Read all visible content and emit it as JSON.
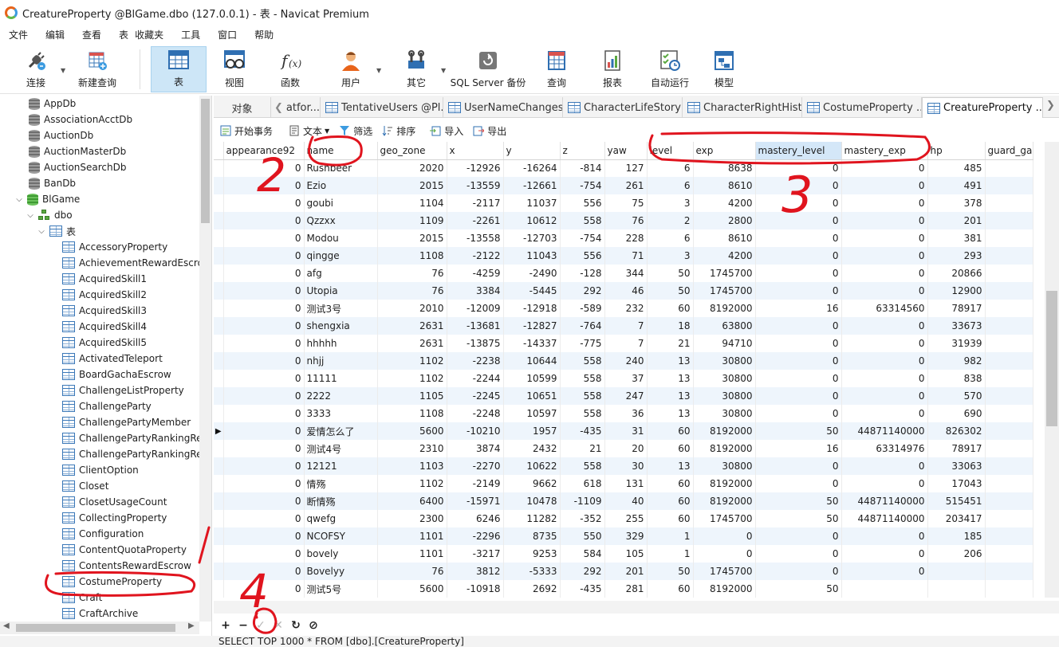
{
  "window": {
    "title": "CreatureProperty @BlGame.dbo (127.0.0.1) - 表 - Navicat Premium"
  },
  "menu": [
    "文件",
    "编辑",
    "查看",
    "表",
    "收藏夹",
    "工具",
    "窗口",
    "帮助"
  ],
  "toolbar": {
    "connect": "连接",
    "new_query": "新建查询",
    "table": "表",
    "view": "视图",
    "function": "函数",
    "user": "用户",
    "other": "其它",
    "backup": "SQL Server 备份",
    "query": "查询",
    "report": "报表",
    "automation": "自动运行",
    "model": "模型"
  },
  "sidebar": {
    "databases": [
      "AppDb",
      "AssociationAcctDb",
      "AuctionDb",
      "AuctionMasterDb",
      "AuctionSearchDb",
      "BanDb",
      "BlGame"
    ],
    "schema": "dbo",
    "tables_node": "表",
    "tables": [
      "AccessoryProperty",
      "AchievementRewardEscro",
      "AcquiredSkill1",
      "AcquiredSkill2",
      "AcquiredSkill3",
      "AcquiredSkill4",
      "AcquiredSkill5",
      "ActivatedTeleport",
      "BoardGachaEscrow",
      "ChallengeListProperty",
      "ChallengeParty",
      "ChallengePartyMember",
      "ChallengePartyRankingRe",
      "ChallengePartyRankingRe",
      "ClientOption",
      "Closet",
      "ClosetUsageCount",
      "CollectingProperty",
      "Configuration",
      "ContentQuotaProperty",
      "ContentsRewardEscrow",
      "CostumeProperty",
      "Craft",
      "CraftArchive"
    ]
  },
  "tabs": [
    "对象",
    "atfor...",
    "TentativeUsers @Pl...",
    "UserNameChanges...",
    "CharacterLifeStory ...",
    "CharacterRightHist...",
    "CostumeProperty ...",
    "CreatureProperty ..."
  ],
  "subtoolbar": {
    "begin_transaction": "开始事务",
    "text": "文本",
    "filter": "筛选",
    "sort": "排序",
    "import": "导入",
    "export": "导出"
  },
  "grid": {
    "columns": [
      "appearance92",
      "name",
      "geo_zone",
      "x",
      "y",
      "z",
      "yaw",
      "level",
      "exp",
      "mastery_level",
      "mastery_exp",
      "hp",
      "guard_ga"
    ],
    "rows": [
      [
        "0",
        "Rushbeer",
        "2020",
        "-12926",
        "-16264",
        "-814",
        "127",
        "6",
        "8638",
        "0",
        "0",
        "485",
        ""
      ],
      [
        "0",
        "Ezio",
        "2015",
        "-13559",
        "-12661",
        "-754",
        "261",
        "6",
        "8610",
        "0",
        "0",
        "491",
        ""
      ],
      [
        "0",
        "goubi",
        "1104",
        "-2117",
        "11037",
        "556",
        "75",
        "3",
        "4200",
        "0",
        "0",
        "378",
        ""
      ],
      [
        "0",
        "Qzzxx",
        "1109",
        "-2261",
        "10612",
        "558",
        "76",
        "2",
        "2800",
        "0",
        "0",
        "201",
        ""
      ],
      [
        "0",
        "Modou",
        "2015",
        "-13558",
        "-12703",
        "-754",
        "228",
        "6",
        "8610",
        "0",
        "0",
        "381",
        ""
      ],
      [
        "0",
        "qingge",
        "1108",
        "-2122",
        "11043",
        "556",
        "71",
        "3",
        "4200",
        "0",
        "0",
        "293",
        ""
      ],
      [
        "0",
        "afg",
        "76",
        "-4259",
        "-2490",
        "-128",
        "344",
        "50",
        "1745700",
        "0",
        "0",
        "20866",
        ""
      ],
      [
        "0",
        "Utopia",
        "76",
        "3384",
        "-5445",
        "292",
        "46",
        "50",
        "1745700",
        "0",
        "0",
        "12900",
        ""
      ],
      [
        "0",
        "测试3号",
        "2010",
        "-12009",
        "-12918",
        "-589",
        "232",
        "60",
        "8192000",
        "16",
        "63314560",
        "78917",
        ""
      ],
      [
        "0",
        "shengxia",
        "2631",
        "-13681",
        "-12827",
        "-764",
        "7",
        "18",
        "63800",
        "0",
        "0",
        "33673",
        ""
      ],
      [
        "0",
        "hhhhh",
        "2631",
        "-13875",
        "-14337",
        "-775",
        "7",
        "21",
        "94710",
        "0",
        "0",
        "31939",
        ""
      ],
      [
        "0",
        "nhjj",
        "1102",
        "-2238",
        "10644",
        "558",
        "240",
        "13",
        "30800",
        "0",
        "0",
        "982",
        ""
      ],
      [
        "0",
        "11111",
        "1102",
        "-2244",
        "10599",
        "558",
        "37",
        "13",
        "30800",
        "0",
        "0",
        "838",
        ""
      ],
      [
        "0",
        "2222",
        "1105",
        "-2245",
        "10651",
        "558",
        "247",
        "13",
        "30800",
        "0",
        "0",
        "570",
        ""
      ],
      [
        "0",
        "3333",
        "1108",
        "-2248",
        "10597",
        "558",
        "36",
        "13",
        "30800",
        "0",
        "0",
        "690",
        ""
      ],
      [
        "0",
        "爱情怎么了",
        "5600",
        "-10210",
        "1957",
        "-435",
        "31",
        "60",
        "8192000",
        "50",
        "44871140000",
        "826302",
        ""
      ],
      [
        "0",
        "测试4号",
        "2310",
        "3874",
        "2432",
        "21",
        "20",
        "60",
        "8192000",
        "16",
        "63314976",
        "78917",
        ""
      ],
      [
        "0",
        "12121",
        "1103",
        "-2270",
        "10622",
        "558",
        "30",
        "13",
        "30800",
        "0",
        "0",
        "33063",
        ""
      ],
      [
        "0",
        "情殇",
        "1102",
        "-2149",
        "9662",
        "618",
        "131",
        "60",
        "8192000",
        "0",
        "0",
        "17043",
        ""
      ],
      [
        "0",
        "断情殇",
        "6400",
        "-15971",
        "10478",
        "-1109",
        "40",
        "60",
        "8192000",
        "50",
        "44871140000",
        "515451",
        ""
      ],
      [
        "0",
        "qwefg",
        "2300",
        "6246",
        "11282",
        "-352",
        "255",
        "60",
        "1745700",
        "50",
        "44871140000",
        "203417",
        ""
      ],
      [
        "0",
        "NCOFSY",
        "1101",
        "-2296",
        "8735",
        "550",
        "329",
        "1",
        "0",
        "0",
        "0",
        "185",
        ""
      ],
      [
        "0",
        "bovely",
        "1101",
        "-3217",
        "9253",
        "584",
        "105",
        "1",
        "0",
        "0",
        "0",
        "206",
        ""
      ],
      [
        "0",
        "Bovelyy",
        "76",
        "3812",
        "-5333",
        "292",
        "201",
        "50",
        "1745700",
        "0",
        "0",
        "",
        ""
      ],
      [
        "0",
        "测试5号",
        "5600",
        "-10918",
        "2692",
        "-435",
        "281",
        "60",
        "8192000",
        "50",
        "",
        "",
        " "
      ]
    ],
    "current_row_index": 15
  },
  "status": {
    "sql": "SELECT TOP 1000 * FROM [dbo].[CreatureProperty]",
    "bottom_buttons": [
      "+",
      "−",
      "✓",
      "✕",
      "↻",
      "⊘"
    ]
  },
  "annotations": [
    "2",
    "3",
    "1",
    "4"
  ],
  "colors": {
    "accent": "#cde6f7",
    "annotation": "#e0141e",
    "row_alt": "#eef5fc"
  }
}
